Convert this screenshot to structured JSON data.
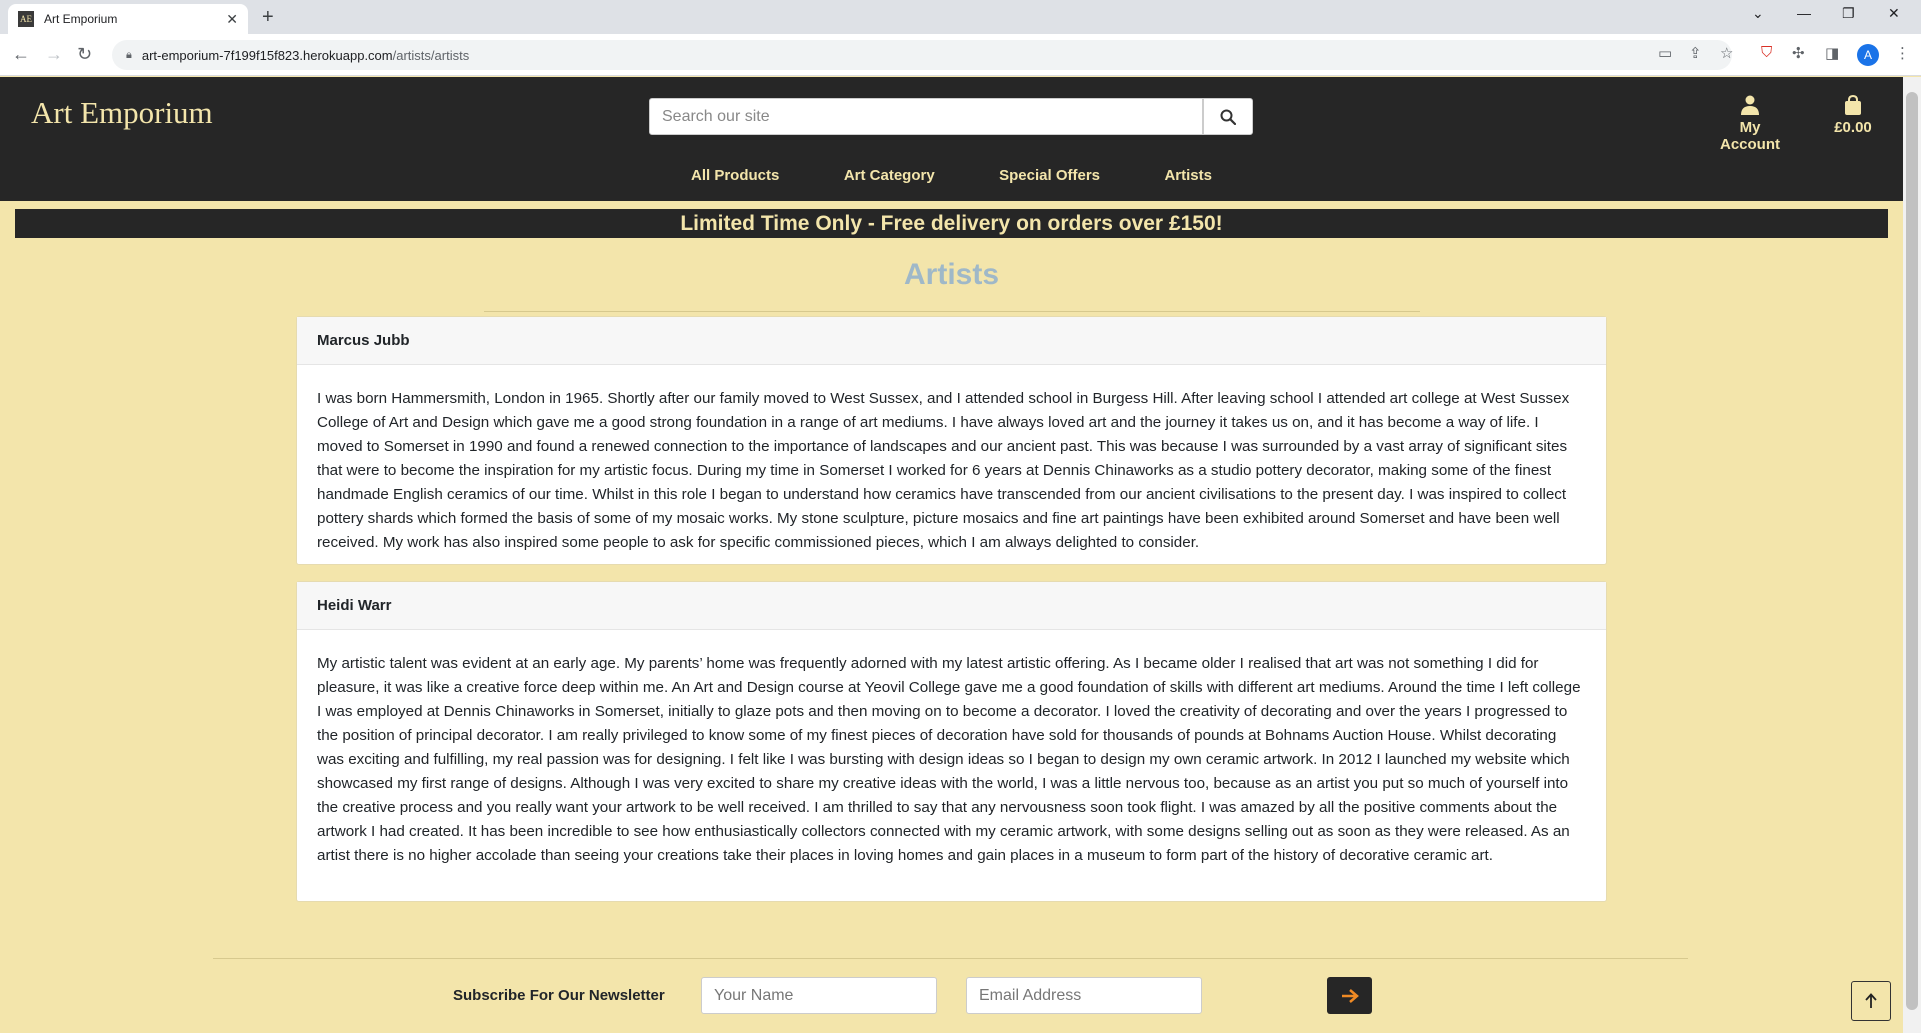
{
  "browser": {
    "tab_title": "Art Emporium",
    "favicon_text": "AE",
    "url_host": "art-emporium-7f199f15f823.herokuapp.com",
    "url_path": "/artists/artists",
    "profile_initial": "A"
  },
  "header": {
    "logo": "Art Emporium",
    "search_placeholder": "Search our site",
    "account_label": "My Account",
    "cart_total": "£0.00"
  },
  "nav": {
    "items": [
      "All Products",
      "Art Category",
      "Special Offers",
      "Artists"
    ]
  },
  "promo": "Limited Time Only - Free delivery on orders over £150!",
  "page_title": "Artists",
  "artists": [
    {
      "name": "Marcus Jubb",
      "bio": "I was born Hammersmith, London in 1965. Shortly after our family moved to West Sussex, and I attended school in Burgess Hill. After leaving school I attended art college at West Sussex College of Art and Design which gave me a good strong foundation in a range of art mediums. I have always loved art and the journey it takes us on, and it has become a way of life. I moved to Somerset in 1990 and found a renewed connection to the importance of landscapes and our ancient past. This was because I was surrounded by a vast array of significant sites that were to become the inspiration for my artistic focus. During my time in Somerset I worked for 6 years at Dennis Chinaworks as a studio pottery decorator, making some of the finest handmade English ceramics of our time. Whilst in this role I began to understand how ceramics have transcended from our ancient civilisations to the present day. I was inspired to collect pottery shards which formed the basis of some of my mosaic works. My stone sculpture, picture mosaics and fine art paintings have been exhibited around Somerset and have been well received. My work has also inspired some people to ask for specific commissioned pieces, which I am always delighted to consider."
    },
    {
      "name": "Heidi Warr",
      "bio": "My artistic talent was evident at an early age. My parents’ home was frequently adorned with my latest artistic offering. As I became older I realised that art was not something I did for pleasure, it was like a creative force deep within me. An Art and Design course at Yeovil College gave me a good foundation of skills with different art mediums. Around the time I left college I was employed at Dennis Chinaworks in Somerset, initially to glaze pots and then moving on to become a decorator. I loved the creativity of decorating and over the years I progressed to the position of principal decorator. I am really privileged to know some of my finest pieces of decoration have sold for thousands of pounds at Bohnams Auction House. Whilst decorating was exciting and fulfilling, my real passion was for designing. I felt like I was bursting with design ideas so I began to design my own ceramic artwork. In 2012 I launched my website which showcased my first range of designs. Although I was very excited to share my creative ideas with the world, I was a little nervous too, because as an artist you put so much of yourself into the creative process and you really want your artwork to be well received. I am thrilled to say that any nervousness soon took flight. I was amazed by all the positive comments about the artwork I had created. It has been incredible to see how enthusiastically collectors connected with my ceramic artwork, with some designs selling out as soon as they were released. As an artist there is no higher accolade than seeing your creations take their places in loving homes and gain places in a museum to form part of the history of decorative ceramic art."
    }
  ],
  "newsletter": {
    "label": "Subscribe For Our Newsletter",
    "name_placeholder": "Your Name",
    "email_placeholder": "Email Address"
  },
  "colors": {
    "header_bg": "#262626",
    "page_bg": "#f3e5ab",
    "accent_text": "#f3e5ab",
    "title_color": "#9fb8c8",
    "arrow_orange": "#f08a24"
  }
}
